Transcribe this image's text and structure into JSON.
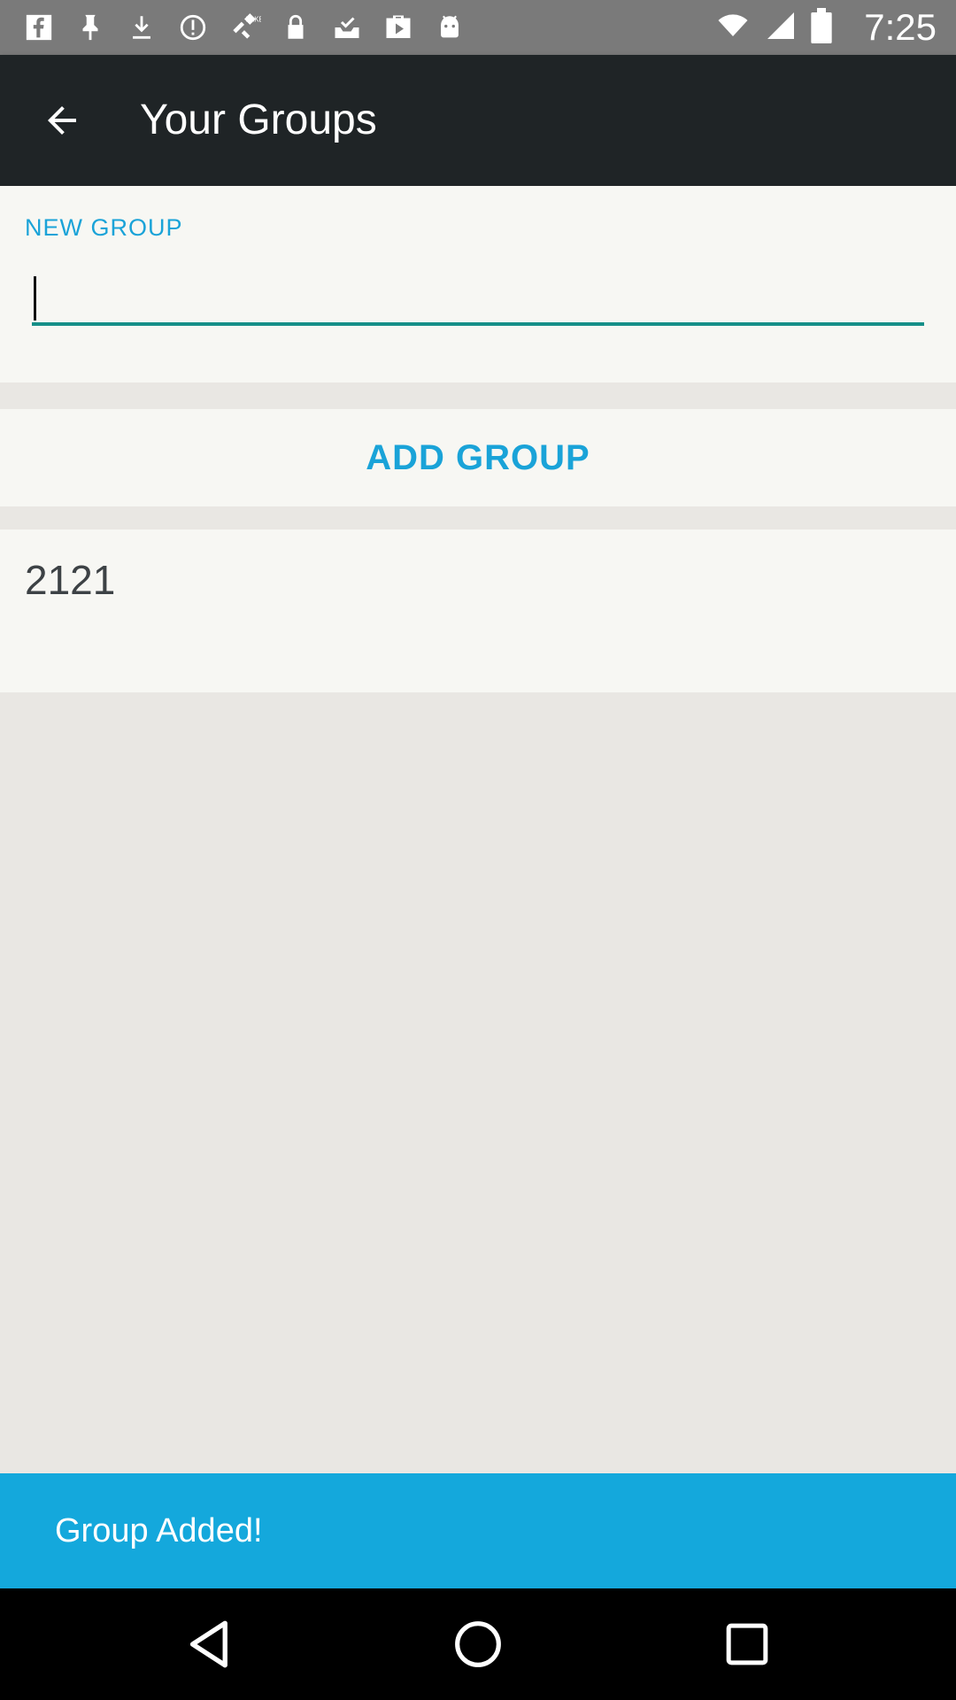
{
  "status_bar": {
    "time": "7:25",
    "notification_icons": [
      "f-icon",
      "pin-icon",
      "download-icon",
      "info-circle-icon",
      "satellite-fake-icon",
      "lock-icon",
      "inbox-check-icon",
      "briefcase-play-icon",
      "android-icon"
    ],
    "system_icons": [
      "wifi-icon",
      "signal-icon",
      "battery-icon"
    ]
  },
  "app_bar": {
    "title": "Your Groups",
    "back_icon": "arrow-back-icon"
  },
  "new_group": {
    "label": "NEW GROUP",
    "input_value": ""
  },
  "actions": {
    "add_group_label": "ADD GROUP"
  },
  "groups": {
    "items": [
      {
        "name": "2121"
      }
    ]
  },
  "snackbar": {
    "message": "Group Added!"
  },
  "colors": {
    "accent": "#1aa3d8",
    "app_bar_bg": "#1f2426",
    "input_underline": "#168f88",
    "snackbar_bg": "#14a8dc"
  }
}
